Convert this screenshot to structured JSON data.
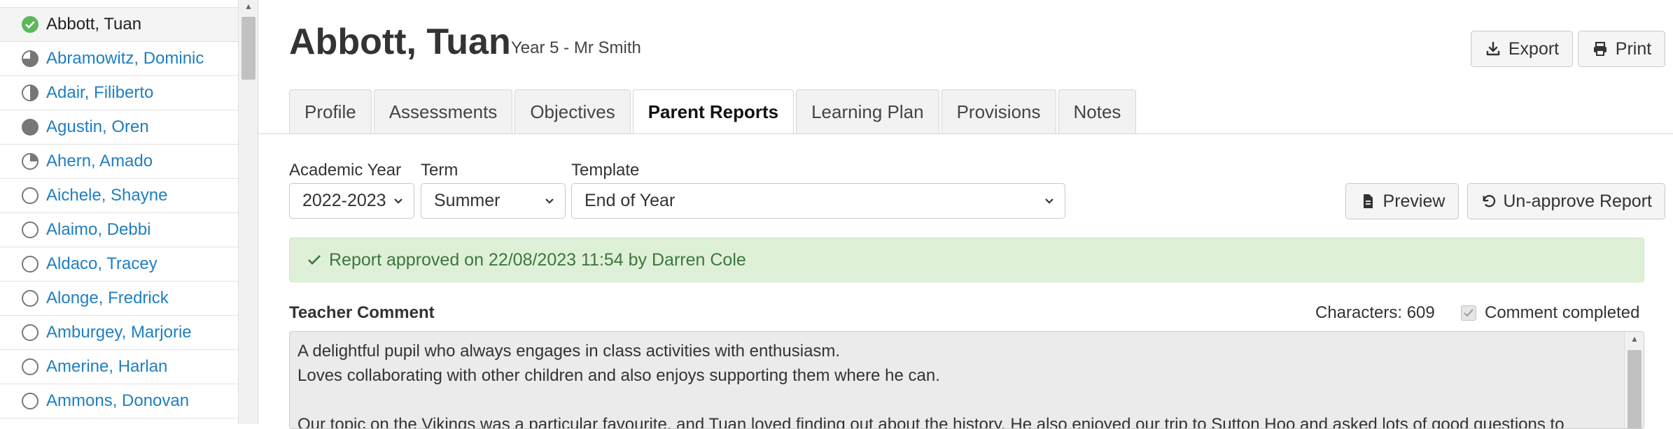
{
  "sidebar": {
    "students": [
      {
        "name": "",
        "status": "none"
      },
      {
        "name": "Abbott, Tuan",
        "status": "complete",
        "selected": true
      },
      {
        "name": "Abramowitz, Dominic",
        "status": "three-quarter"
      },
      {
        "name": "Adair, Filiberto",
        "status": "half"
      },
      {
        "name": "Agustin, Oren",
        "status": "full"
      },
      {
        "name": "Ahern, Amado",
        "status": "quarter"
      },
      {
        "name": "Aichele, Shayne",
        "status": "empty"
      },
      {
        "name": "Alaimo, Debbi",
        "status": "empty"
      },
      {
        "name": "Aldaco, Tracey",
        "status": "empty"
      },
      {
        "name": "Alonge, Fredrick",
        "status": "empty"
      },
      {
        "name": "Amburgey, Marjorie",
        "status": "empty"
      },
      {
        "name": "Amerine, Harlan",
        "status": "empty"
      },
      {
        "name": "Ammons, Donovan",
        "status": "empty"
      }
    ]
  },
  "header": {
    "student_name": "Abbott, Tuan",
    "class_info": "Year 5 - Mr Smith",
    "export_label": "Export",
    "print_label": "Print"
  },
  "tabs": [
    {
      "label": "Profile"
    },
    {
      "label": "Assessments"
    },
    {
      "label": "Objectives"
    },
    {
      "label": "Parent Reports",
      "active": true
    },
    {
      "label": "Learning Plan"
    },
    {
      "label": "Provisions"
    },
    {
      "label": "Notes"
    }
  ],
  "filters": {
    "academic_year_label": "Academic Year",
    "academic_year_value": "2022-2023",
    "term_label": "Term",
    "term_value": "Summer",
    "template_label": "Template",
    "template_value": "End of Year"
  },
  "actions": {
    "preview_label": "Preview",
    "unapprove_label": "Un-approve Report"
  },
  "alert": {
    "text": "Report approved on 22/08/2023 11:54 by Darren Cole"
  },
  "comment": {
    "label": "Teacher Comment",
    "char_count": "Characters: 609",
    "completed_label": "Comment completed",
    "completed_checked": true,
    "lines": [
      "A delightful pupil who always engages in class activities with enthusiasm.",
      "Loves collaborating with other children and also enjoys supporting them where he can.",
      "",
      "Our topic on the Vikings was a particular favourite, and Tuan loved finding out about the history. He also enjoyed our trip to Sutton Hoo and asked lots of good questions to"
    ]
  },
  "colors": {
    "link": "#1f7fc0",
    "status_green": "#5cb85c",
    "status_gray": "#777777",
    "alert_bg": "#dff0d8",
    "alert_text": "#3c763d"
  }
}
